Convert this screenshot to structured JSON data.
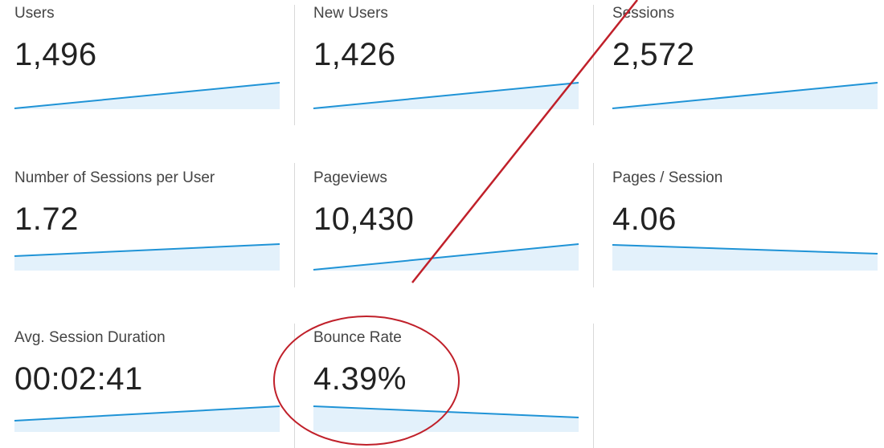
{
  "metrics": [
    {
      "label": "Users",
      "value": "1,496",
      "trend": "up"
    },
    {
      "label": "New Users",
      "value": "1,426",
      "trend": "up"
    },
    {
      "label": "Sessions",
      "value": "2,572",
      "trend": "up"
    },
    {
      "label": "Number of Sessions per User",
      "value": "1.72",
      "trend": "up"
    },
    {
      "label": "Pageviews",
      "value": "10,430",
      "trend": "up"
    },
    {
      "label": "Pages / Session",
      "value": "4.06",
      "trend": "down"
    },
    {
      "label": "Avg. Session Duration",
      "value": "00:02:41",
      "trend": "up"
    },
    {
      "label": "Bounce Rate",
      "value": "4.39%",
      "trend": "down"
    }
  ],
  "colors": {
    "sparkline_line": "#1f93d6",
    "sparkline_fill": "#e3f1fb",
    "annotation": "#c0202a",
    "divider": "#d9d9d9"
  }
}
